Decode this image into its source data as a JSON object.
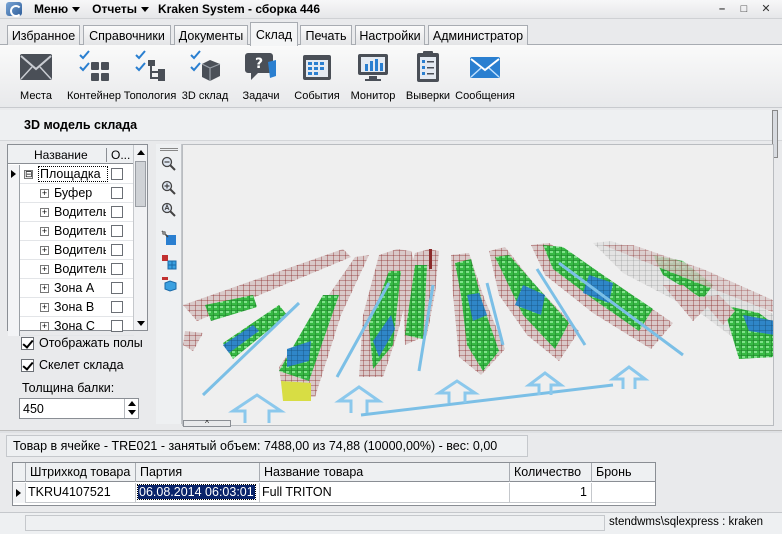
{
  "titlebar": {
    "menu_label": "Меню",
    "reports_label": "Отчеты",
    "title": "Kraken System - сборка 446",
    "minimize": "–",
    "maximize": "□",
    "close": "✕"
  },
  "tabs": [
    {
      "label": "Избранное"
    },
    {
      "label": "Справочники"
    },
    {
      "label": "Документы"
    },
    {
      "label": "Склад",
      "active": true
    },
    {
      "label": "Печать"
    },
    {
      "label": "Настройки"
    },
    {
      "label": "Администратор"
    }
  ],
  "ribbon": [
    {
      "label": "Места",
      "icon": "envelope-dark-icon"
    },
    {
      "label": "Контейнер",
      "icon": "container-icon"
    },
    {
      "label": "Топология",
      "icon": "topology-icon"
    },
    {
      "label": "3D склад",
      "icon": "cube-3d-icon"
    },
    {
      "label": "Задачи",
      "icon": "tasks-bubble-icon"
    },
    {
      "label": "События",
      "icon": "calendar-icon"
    },
    {
      "label": "Монитор",
      "icon": "monitor-chart-icon"
    },
    {
      "label": "Выверки",
      "icon": "checklist-icon"
    },
    {
      "label": "Сообщения",
      "icon": "mail-icon"
    }
  ],
  "section": {
    "title": "3D модель склада"
  },
  "tree": {
    "col_name": "Название",
    "col_o": "О...",
    "rows": [
      {
        "label": "Площадка",
        "level": 0,
        "expander": "⊟",
        "selected": true
      },
      {
        "label": "Буфер",
        "level": 1,
        "expander": "+"
      },
      {
        "label": "Водитель",
        "level": 1,
        "expander": "+"
      },
      {
        "label": "Водитель",
        "level": 1,
        "expander": "+"
      },
      {
        "label": "Водитель",
        "level": 1,
        "expander": "+"
      },
      {
        "label": "Водитель",
        "level": 1,
        "expander": "+"
      },
      {
        "label": "Зона А",
        "level": 1,
        "expander": "+"
      },
      {
        "label": "Зона В",
        "level": 1,
        "expander": "+"
      },
      {
        "label": "Зона С",
        "level": 1,
        "expander": "+"
      }
    ]
  },
  "options": {
    "show_label": "Отображать полы",
    "show_checked": true,
    "skeleton_label": "Скелет склада",
    "skeleton_checked": true,
    "thickness_label": "Толщина балки:",
    "thickness_value": "450"
  },
  "info": {
    "text": "Товар в ячейке - TRE021 - занятый объем: 7488,00 из 74,88 (10000,00%)  - вес: 0,00"
  },
  "grid": {
    "columns": [
      "Штрихкод товара",
      "Партия",
      "Название товара",
      "Количество",
      "Бронь"
    ],
    "rows": [
      {
        "barcode": "TKRU4107521",
        "batch": "06.08.2014 06:03:01",
        "name": "Full TRITON",
        "qty": "1",
        "reserve": ""
      }
    ]
  },
  "status": {
    "connection": "stendwms\\sqlexpress : kraken"
  },
  "colors": {
    "accent_blue": "#7bbfe6",
    "rack_green": "#2fb83a",
    "rack_red": "#8b2a2a"
  }
}
